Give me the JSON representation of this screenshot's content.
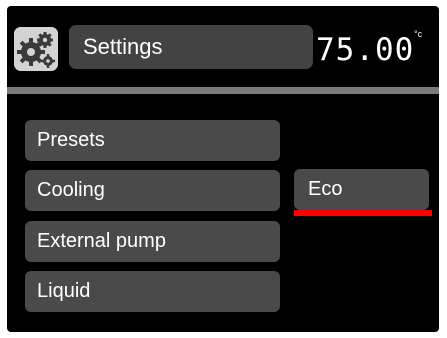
{
  "header": {
    "title": "Settings",
    "temperature": "75.00",
    "temperature_unit": "°c",
    "icon": "gears-icon"
  },
  "menu": {
    "items": [
      {
        "label": "Presets"
      },
      {
        "label": "Cooling"
      },
      {
        "label": "External pump"
      },
      {
        "label": "Liquid"
      }
    ]
  },
  "selection": {
    "value": "Eco",
    "indicator_color": "#ff0000"
  },
  "colors": {
    "background": "#000000",
    "button": "#4a4a4a",
    "divider": "#7a7a7a",
    "text": "#ffffff"
  }
}
